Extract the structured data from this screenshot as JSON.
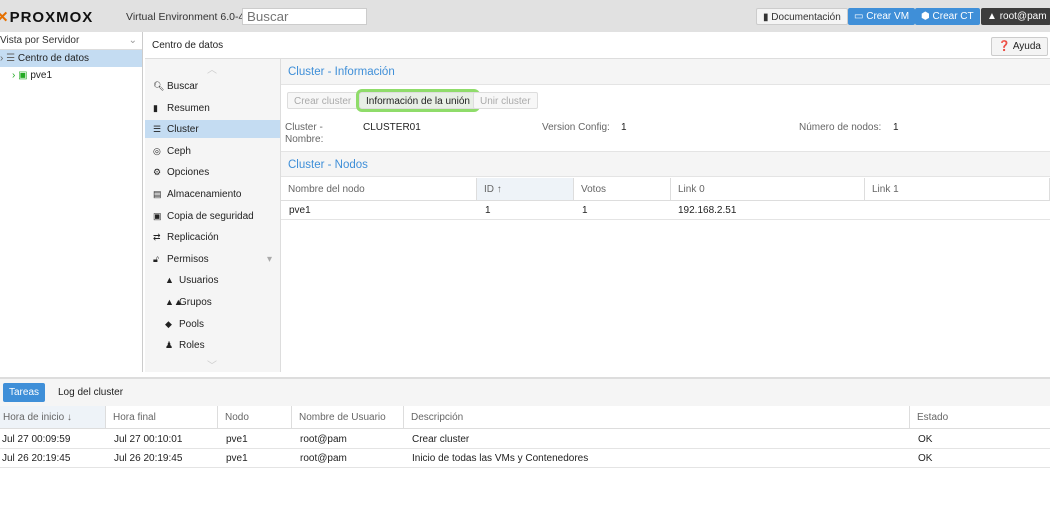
{
  "header": {
    "logo": "PROXMOX",
    "version": "Virtual Environment 6.0-4",
    "search_placeholder": "Buscar",
    "docs": "Documentación",
    "create_vm": "Crear VM",
    "create_ct": "Crear CT",
    "user": "root@pam"
  },
  "tree": {
    "view": "Vista por Servidor",
    "datacenter": "Centro de datos",
    "node": "pve1"
  },
  "content": {
    "title": "Centro de datos",
    "help": "Ayuda"
  },
  "menu": [
    "Buscar",
    "Resumen",
    "Cluster",
    "Ceph",
    "Opciones",
    "Almacenamiento",
    "Copia de seguridad",
    "Replicación",
    "Permisos",
    "Usuarios",
    "Grupos",
    "Pools",
    "Roles"
  ],
  "cluster": {
    "info_title": "Cluster - Información",
    "create": "Crear cluster",
    "join_info": "Información de la unión",
    "join": "Unir cluster",
    "name_label": "Cluster - Nombre:",
    "name": "CLUSTER01",
    "version_label": "Version Config:",
    "version": "1",
    "nodes_label": "Número de nodos:",
    "nodes": "1",
    "nodes_title": "Cluster - Nodos",
    "columns": [
      "Nombre del nodo",
      "ID ↑",
      "Votos",
      "Link 0",
      "Link 1"
    ],
    "rows": [
      [
        "pve1",
        "1",
        "1",
        "192.168.2.51",
        ""
      ]
    ]
  },
  "bottom": {
    "tabs": [
      "Tareas",
      "Log del cluster"
    ],
    "columns": [
      "Hora de inicio ↓",
      "Hora final",
      "Nodo",
      "Nombre de Usuario",
      "Descripción",
      "Estado"
    ],
    "rows": [
      [
        "Jul 27 00:09:59",
        "Jul 27 00:10:01",
        "pve1",
        "root@pam",
        "Crear cluster",
        "OK"
      ],
      [
        "Jul 26 20:19:45",
        "Jul 26 20:19:45",
        "pve1",
        "root@pam",
        "Inicio de todas las VMs y Contenedores",
        "OK"
      ]
    ]
  }
}
